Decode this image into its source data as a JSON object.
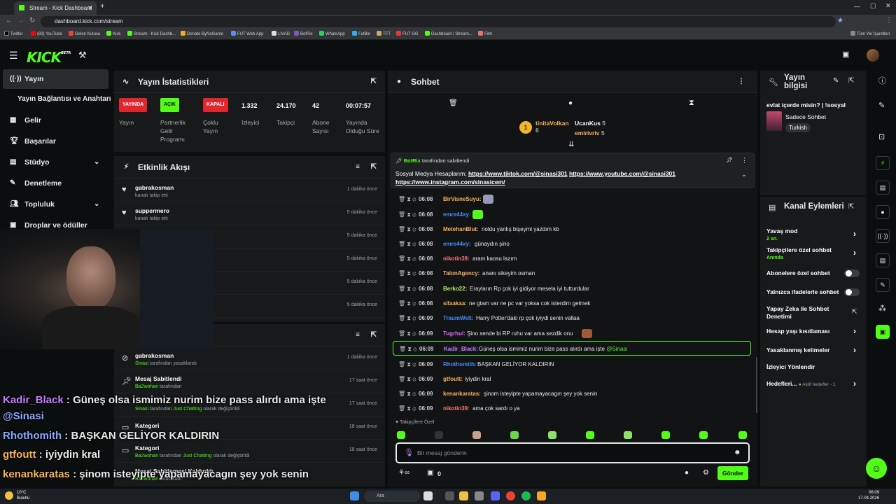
{
  "browser": {
    "tab1": "Stream - Kick Dashboard",
    "url": "dashboard.kick.com/stream",
    "bookmarks": [
      "Twitter",
      "(83) YouTube",
      "Gelen Kutusu",
      "Kick",
      "Stream - Kick Dashb...",
      "Donate ByNoGame",
      "FUT Web App",
      "LIVAD",
      "BotRix",
      "WhatsApp",
      "FutBin",
      "TFT",
      "FUT GG",
      "Dashboard / Stream...",
      "Film"
    ],
    "all_bookmarks": "Tüm Yer İşaretleri"
  },
  "brand": {
    "name": "KICK",
    "beta": "BETA",
    "accent": "#53fc18"
  },
  "sidebar": {
    "items": [
      {
        "icon": "broadcast-icon",
        "label": "Yayın"
      },
      {
        "label": "Yayın Bağlantısı ve Anahtarı"
      },
      {
        "icon": "dollar-icon",
        "label": "Gelir"
      },
      {
        "icon": "trophy-icon",
        "label": "Başarılar"
      },
      {
        "icon": "studio-icon",
        "label": "Stüdyo"
      },
      {
        "icon": "wrench-icon",
        "label": "Denetleme"
      },
      {
        "icon": "people-icon",
        "label": "Topluluk"
      },
      {
        "icon": "gift-icon",
        "label": "Droplar ve ödüller"
      }
    ]
  },
  "stats": {
    "title": "Yayın İstatistikleri",
    "live_badge": "YAYINDA",
    "live_label": "Yayın",
    "partner_badge": "AÇIK",
    "partner_label": "Partnerlik Gelir Programı",
    "multi_badge": "KAPALI",
    "multi_label": "Çoklu Yayın",
    "viewers": "1.332",
    "viewers_label": "İzleyici",
    "followers": "24.170",
    "followers_label": "Takipçi",
    "subs": "42",
    "subs_label": "Abone Sayısı",
    "duration": "00:07:57",
    "duration_label": "Yayında Olduğu Süre"
  },
  "activity": {
    "title": "Etkinlik Akışı",
    "items": [
      {
        "name": "gabrakosman",
        "desc": "kanalı takip etti",
        "time": "1 dakika önce"
      },
      {
        "name": "suppermero",
        "desc": "kanalı takip etti",
        "time": "5 dakika önce"
      },
      {
        "time": "5 dakika önce"
      },
      {
        "time": "5 dakika önce"
      },
      {
        "time": "5 dakika önce"
      },
      {
        "time": "5 dakika önce"
      }
    ]
  },
  "modlog": {
    "items": [
      {
        "name": "gabrakosman",
        "user": "Sinasi",
        "desc": "tarafından yasaklandı",
        "time": "1 dakika önce"
      },
      {
        "name": "Mesaj Sabitlendi",
        "user": "Ba2wohan",
        "desc": "tarafından",
        "time": "17 saat önce"
      },
      {
        "user": "Sinasi",
        "desc": "tarafından",
        "cat": "Just Chatting",
        "desc2": "olarak değiştirildi",
        "time": "17 saat önce"
      },
      {
        "name": "Kategori",
        "time": "18 saat önce"
      },
      {
        "name": "Kategori",
        "user": "Ba2wohan",
        "desc": "tarafından",
        "cat": "Just Chatting",
        "desc2": "olarak değiştirildi",
        "time": "18 saat önce"
      },
      {
        "name": "Mesaj Sabitlemesi Kaldırıldı",
        "user": "Ba2wohan",
        "desc": "tarafından"
      }
    ]
  },
  "chat": {
    "title": "Sohbet",
    "gifters": [
      {
        "name": "tinitaVolkan",
        "count": "6"
      },
      {
        "name": "UcanKus",
        "count": "5"
      },
      {
        "name": "emirivriv",
        "count": "5"
      }
    ],
    "rank": "1",
    "pinned": {
      "by": "BotRix",
      "by_suffix": "tarafından sabitlendi",
      "line1": "Sosyal Medya Hesaplarım;",
      "link1": "https://www.tiktok.com/@sinasi301",
      "link2": "https://www.youtube.com/@sinasi301",
      "link3": "https://www.instagram.com/sinasicem/"
    },
    "messages": [
      {
        "time": "06:08",
        "user": "BirVisneSuyu",
        "color": "#fbb25a",
        "text": ""
      },
      {
        "time": "06:08",
        "user": "emre44xy",
        "color": "#4b8bf5",
        "text": ""
      },
      {
        "time": "06:08",
        "user": "MetehanBlut",
        "color": "#fbb25a",
        "text": "noldu yanlış bişeymi yazdım kb"
      },
      {
        "time": "06:08",
        "user": "emre44xy",
        "color": "#4b8bf5",
        "text": "günaydın şino"
      },
      {
        "time": "06:08",
        "user": "nikotin39",
        "color": "#ff7676",
        "text": "aram kaosu lazım"
      },
      {
        "time": "06:08",
        "user": "TalonAgency",
        "color": "#fbb25a",
        "text": "ananı sikeyim osman"
      },
      {
        "time": "06:08",
        "user": "Berko22",
        "color": "#b9e86b",
        "text": "Erayların Rp çok iyi gidiyor mesela iyi tutturdular"
      },
      {
        "time": "06:08",
        "user": "silaakaa",
        "color": "#fbb25a",
        "text": "ne gtam var ne pc var yoksa cok isterdim gelmek"
      },
      {
        "time": "06:09",
        "user": "TraumWelt",
        "color": "#4b8bf5",
        "text": "Harry Potter'daki rp çok iyiydi senin vallaa"
      },
      {
        "time": "06:09",
        "user": "Tugrhul",
        "color": "#e06bf5",
        "text": "Şino sende bi RP ruhu var ama sezdik onu"
      },
      {
        "time": "06:09",
        "user": "Kadir_Black",
        "color": "#c77dff",
        "text": "Güneş olsa ismimiz nurim bize pass alırdı ama işte",
        "mention": "@Sinasi"
      },
      {
        "time": "06:09",
        "user": "Rhothomith",
        "color": "#4b8bf5",
        "text": "BAŞKAN GELİYOR KALDIRIN"
      },
      {
        "time": "06:09",
        "user": "gtfoutt",
        "color": "#fbb25a",
        "text": "iyiydin kral"
      },
      {
        "time": "06:09",
        "user": "kenankaratas",
        "color": "#fbb25a",
        "text": "şinom isteyipte yapamayacagın şey yok senin"
      },
      {
        "time": "06:09",
        "user": "nikotin39",
        "color": "#ff7676",
        "text": "ama çok sardı o ya"
      }
    ],
    "followers_only": "Takipçilere Özel",
    "input_placeholder": "Bir mesaj gönderin",
    "count": "0",
    "send": "Gönder"
  },
  "stream_info": {
    "title": "Yayın bilgisi",
    "stream_title": "evlat içerde misin? | !sosyal",
    "category": "Sadece Sohbet",
    "language": "Turkish"
  },
  "channel_actions": {
    "title": "Kanal Eylemleri",
    "slow_mode": "Yavaş mod",
    "slow_value": "2 sn.",
    "followers_chat": "Takipçilere özel sohbet",
    "followers_value": "Anında",
    "subs_chat": "Abonelere özel sohbet",
    "emotes_only": "Yalnızca ifadelerle sohbet",
    "ai_mod": "Yapay Zeka ile Sohbet Denetimi",
    "account_age": "Hesap yaşı kısıtlaması",
    "banned_words": "Yasaklanmış kelimeler",
    "redirect": "İzleyici Yönlendir",
    "goals": "Hedefleri...",
    "goals_status": "Aktif hedefler - 1"
  },
  "overlay_chat": [
    {
      "user": "Kadir_Black",
      "color": "#c77dff",
      "text": "Güneş olsa ismimiz nurim bize pass alırdı ama işte"
    },
    {
      "mention": "@Sinasi",
      "color": "#8aa6ff"
    },
    {
      "user": "Rhothomith",
      "color": "#8aa6ff",
      "text": "BAŞKAN GELİYOR KALDIRIN"
    },
    {
      "user": "gtfoutt",
      "color": "#fbb25a",
      "text": "iyiydin kral"
    },
    {
      "user": "kenankaratas",
      "color": "#fbb25a",
      "text": "şinom isteyipte yapamayacagın şey yok senin"
    }
  ],
  "taskbar": {
    "weather_temp": "10°C",
    "weather_desc": "Bulutlu",
    "search": "Ara",
    "time": "06:09",
    "date": "17.04.2026"
  }
}
